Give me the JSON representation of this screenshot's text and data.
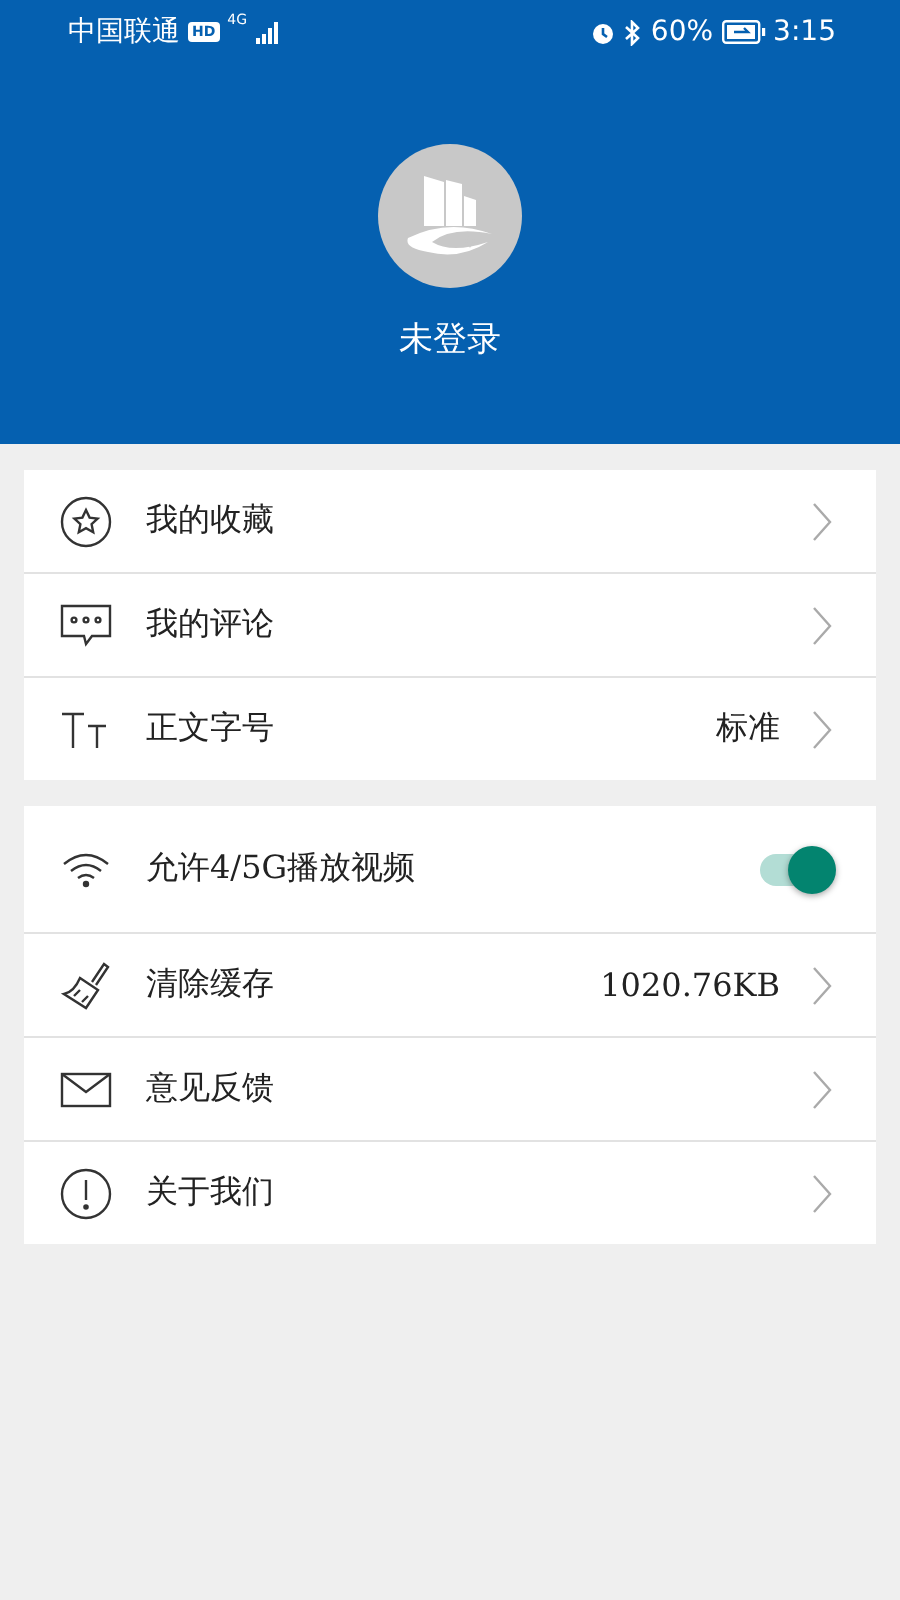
{
  "status_bar": {
    "carrier": "中国联通",
    "hd": "HD",
    "network": "4G",
    "battery": "60%",
    "time": "3:15"
  },
  "profile": {
    "name": "未登录"
  },
  "groups": [
    {
      "items": [
        {
          "kind": "link",
          "label": "我的收藏"
        },
        {
          "kind": "link",
          "label": "我的评论"
        },
        {
          "kind": "link",
          "label": "正文字号",
          "value": "标准"
        }
      ]
    },
    {
      "items": [
        {
          "kind": "toggle",
          "label": "允许4/5G播放视频",
          "on": true
        },
        {
          "kind": "link",
          "label": "清除缓存",
          "value": "1020.76KB"
        },
        {
          "kind": "link",
          "label": "意见反馈"
        },
        {
          "kind": "link",
          "label": "关于我们"
        }
      ]
    }
  ]
}
